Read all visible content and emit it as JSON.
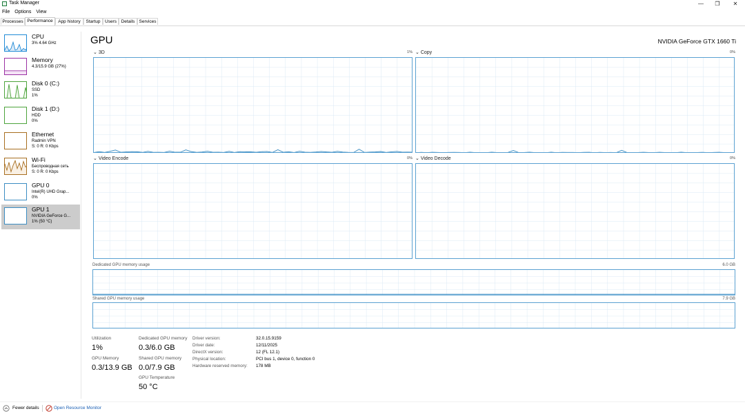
{
  "window": {
    "title": "Task Manager",
    "minimize_glyph": "—",
    "restore_glyph": "❐",
    "close_glyph": "✕"
  },
  "menu": [
    "File",
    "Options",
    "View"
  ],
  "tabs": [
    "Processes",
    "Performance",
    "App history",
    "Startup",
    "Users",
    "Details",
    "Services"
  ],
  "active_tab": "Performance",
  "sidebar": {
    "items": [
      {
        "name": "CPU",
        "line1": "3% 4.64 GHz",
        "line2": "",
        "color": "#1f8ad6",
        "fill": "#dbeaf7"
      },
      {
        "name": "Memory",
        "line1": "4.3/15.9 GB (27%)",
        "line2": "",
        "color": "#9a2fa3",
        "fill": "#f5e4f6"
      },
      {
        "name": "Disk 0 (C:)",
        "line1": "SSD",
        "line2": "1%",
        "color": "#4ba33a",
        "fill": "#eef7ea"
      },
      {
        "name": "Disk 1 (D:)",
        "line1": "HDD",
        "line2": "0%",
        "color": "#4ba33a",
        "fill": "#eef7ea"
      },
      {
        "name": "Ethernet",
        "line1": "Radmin VPN",
        "line2": "S: 0 R: 0 Kbps",
        "color": "#a76d1e",
        "fill": "#f9f0e4"
      },
      {
        "name": "Wi-Fi",
        "line1": "Беспроводная сеть",
        "line2": "S: 0 R: 0 Kbps",
        "color": "#a76d1e",
        "fill": "#f9f0e4"
      },
      {
        "name": "GPU 0",
        "line1": "Intel(R) UHD Grap...",
        "line2": "0%",
        "color": "#3a8cc2",
        "fill": "#e6f1f8"
      },
      {
        "name": "GPU 1",
        "line1": "NVIDIA GeForce G...",
        "line2": "1% (50 °C)",
        "color": "#3a8cc2",
        "fill": "#e6f1f8"
      }
    ],
    "selected_index": 7
  },
  "main": {
    "title": "GPU",
    "device_name": "NVIDIA GeForce GTX 1660 Ti",
    "engines": [
      {
        "label": "3D",
        "max": "1%"
      },
      {
        "label": "Copy",
        "max": "0%"
      },
      {
        "label": "Video Encode",
        "max": "0%"
      },
      {
        "label": "Video Decode",
        "max": "0%"
      }
    ],
    "dedicated_label": "Dedicated GPU memory usage",
    "dedicated_max": "6.0 GB",
    "shared_label": "Shared GPU memory usage",
    "shared_max": "7.9 GB",
    "graph_color": "#3a8cc2"
  },
  "stats": {
    "utilization_label": "Utilization",
    "utilization_value": "1%",
    "dedicated_label": "Dedicated GPU memory",
    "dedicated_value": "0.3/6.0 GB",
    "gpu_memory_label": "GPU Memory",
    "gpu_memory_value": "0.3/13.9 GB",
    "shared_label": "Shared GPU memory",
    "shared_value": "0.0/7.9 GB",
    "temperature_label": "GPU Temperature",
    "temperature_value": "50 °C"
  },
  "details": [
    {
      "key": "Driver version:",
      "value": "32.0.15.9159"
    },
    {
      "key": "Driver date:",
      "value": "12/11/2025"
    },
    {
      "key": "DirectX version:",
      "value": "12 (FL 12.1)"
    },
    {
      "key": "Physical location:",
      "value": "PCI bus 1, device 0, function 0"
    },
    {
      "key": "Hardware reserved memory:",
      "value": "178 MB"
    }
  ],
  "footer": {
    "fewer_details": "Fewer details",
    "open_resource_monitor": "Open Resource Monitor"
  }
}
